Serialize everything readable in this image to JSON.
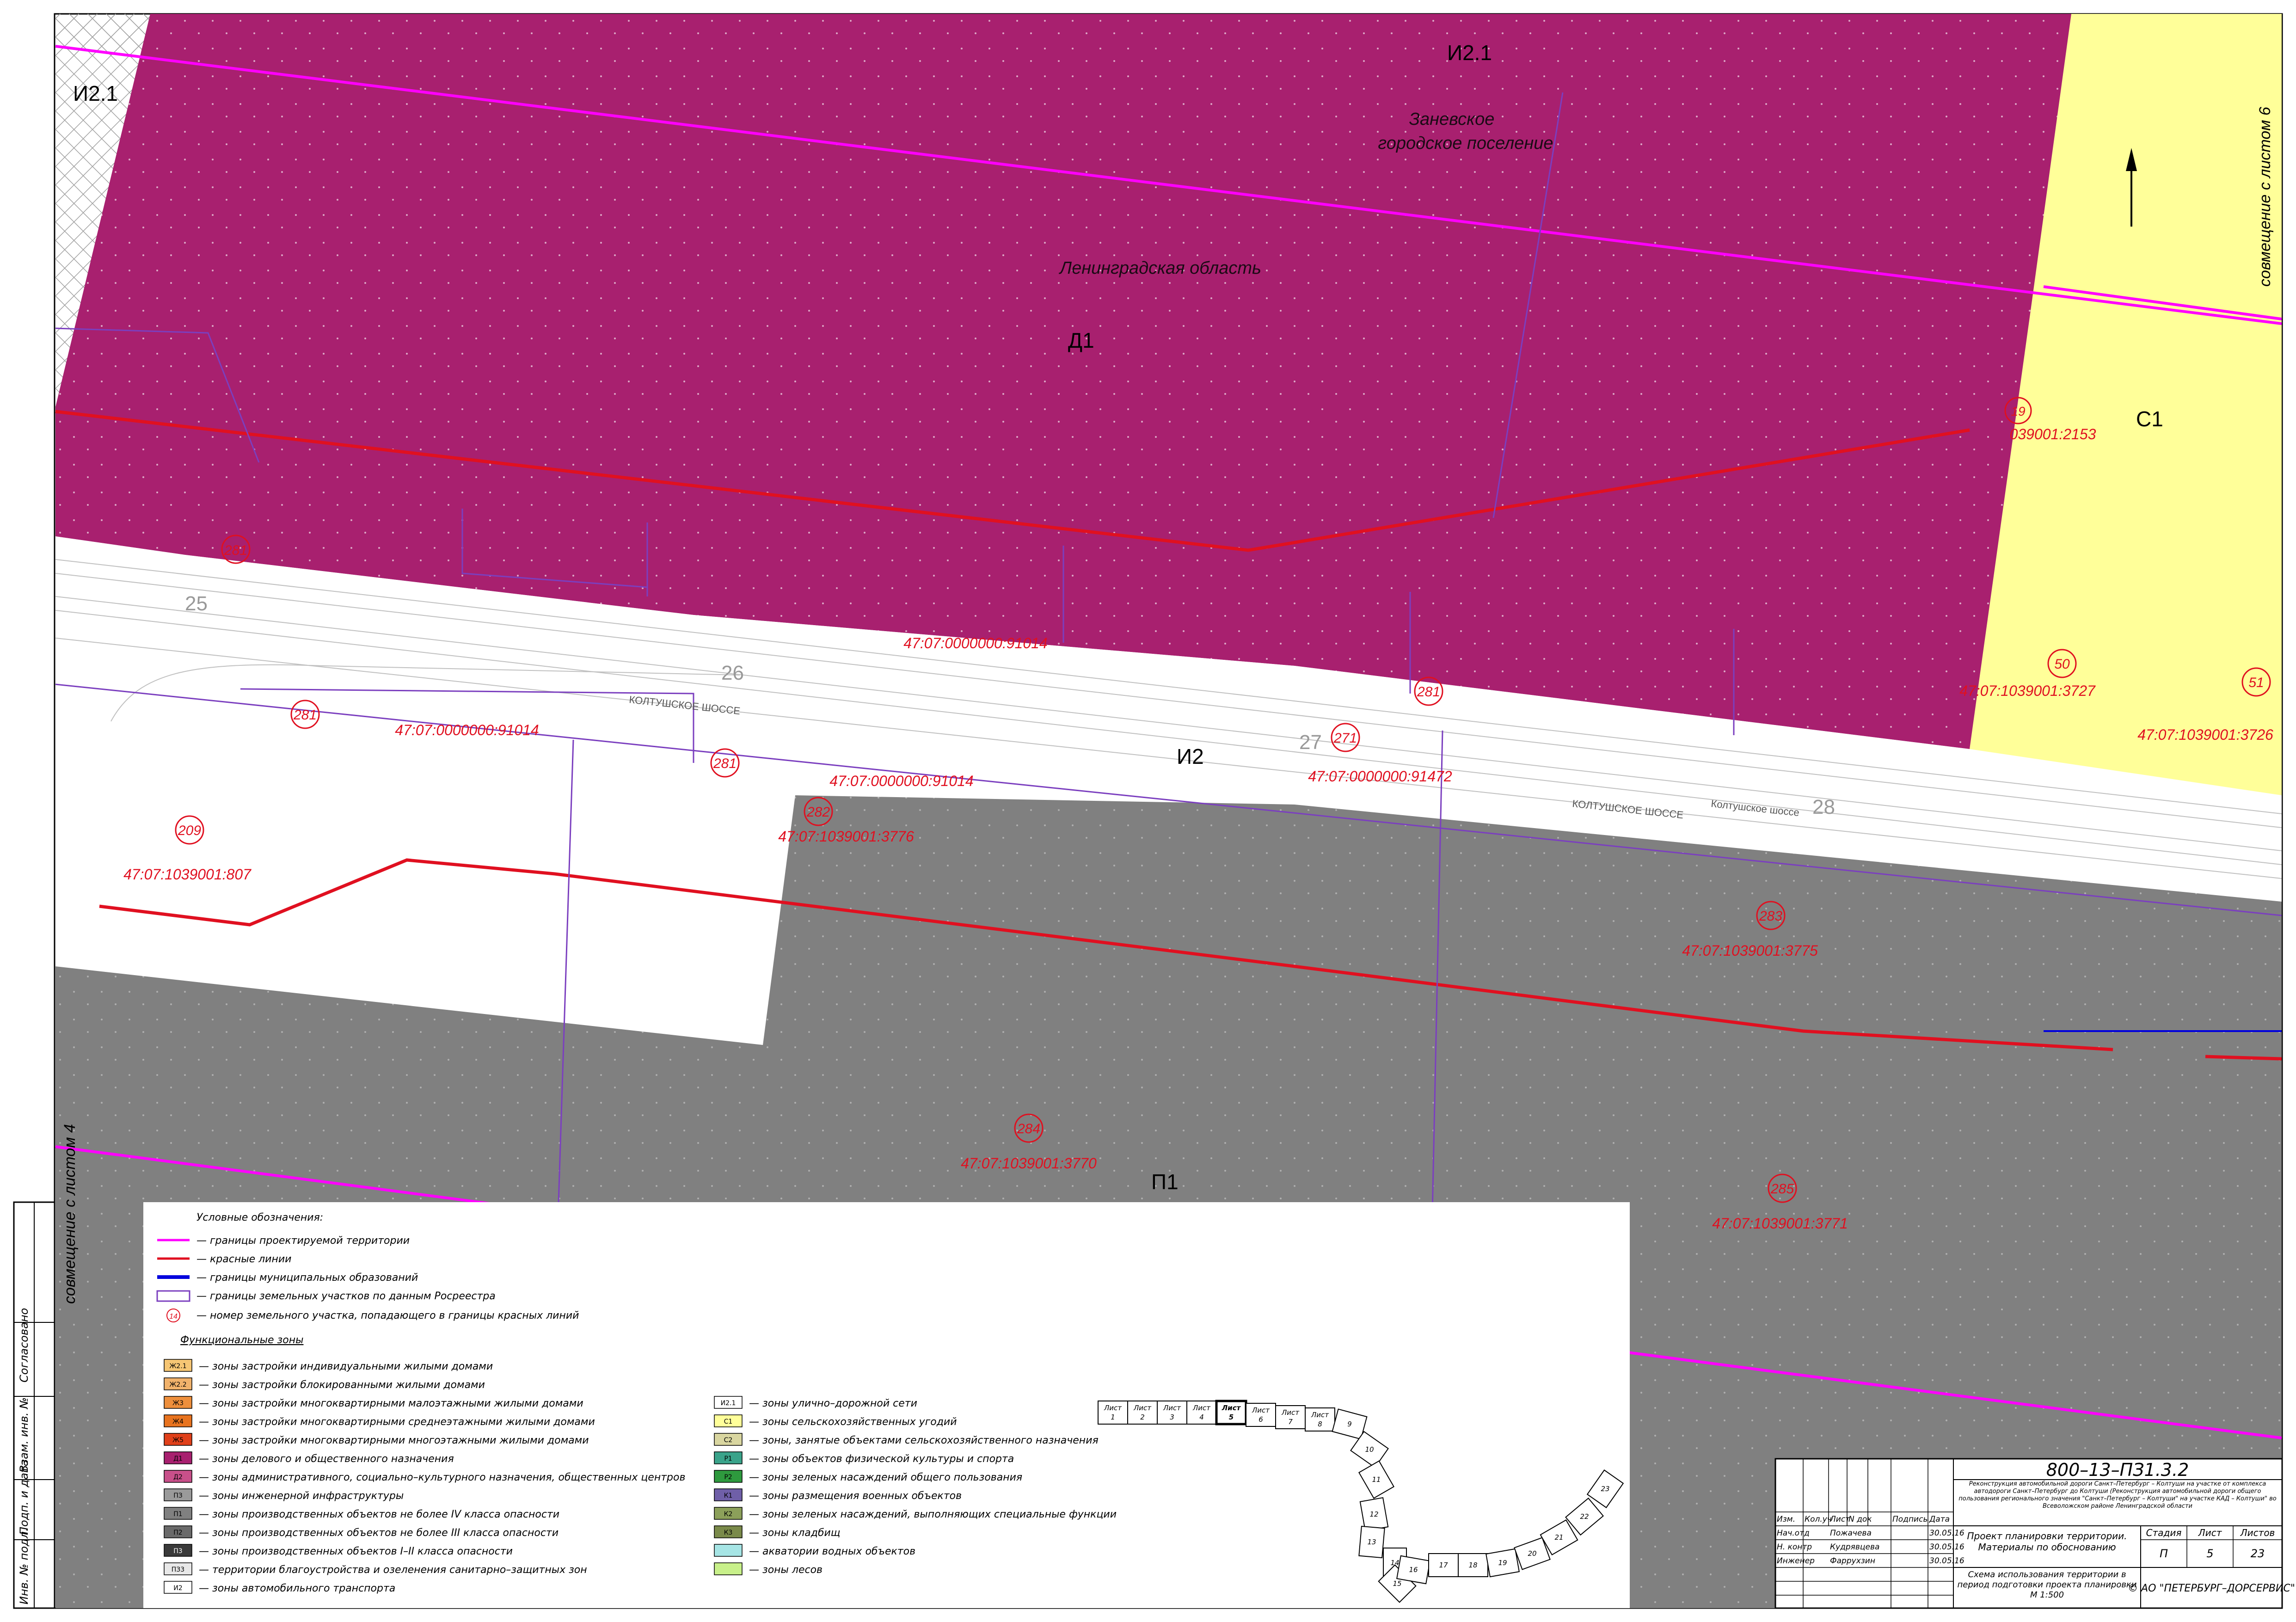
{
  "zones": {
    "d1": {
      "code": "Д1",
      "color": "#a8206f"
    },
    "i2": {
      "code": "И2"
    },
    "i21_left": {
      "code": "И2.1"
    },
    "i21_top": {
      "code": "И2.1"
    },
    "c1": {
      "code": "С1",
      "color": "#ffff99"
    },
    "p1": {
      "code": "П1",
      "color": "#808080"
    }
  },
  "place_labels": {
    "zanevskoe_1": "Заневское",
    "zanevskoe_2": "городское поселение",
    "region": "Ленинградская область"
  },
  "road_labels": {
    "koltushskoe_1": "КОЛТУШСКОЕ ШОССЕ",
    "koltushskoe_2": "КОЛТУШСКОЕ ШОССЕ",
    "koltushskoe_3": "Колтушское шоссе"
  },
  "sheet_numbers": [
    "25",
    "26",
    "27",
    "28"
  ],
  "parcels": [
    {
      "num": "281",
      "cad": "47:07:0000000:91014"
    },
    {
      "num": "281",
      "cad": "47:07:0000000:91014"
    },
    {
      "num": "281",
      "cad": "47:07:0000000:91014"
    },
    {
      "num": "281",
      "cad": ""
    },
    {
      "num": "271",
      "cad": "47:07:0000000:91472"
    },
    {
      "num": "282",
      "cad": "47:07:1039001:3776"
    },
    {
      "num": "209",
      "cad": "47:07:1039001:807"
    },
    {
      "num": "283",
      "cad": "47:07:1039001:3775"
    },
    {
      "num": "284",
      "cad": "47:07:1039001:3770"
    },
    {
      "num": "285",
      "cad": "47:07:1039001:3771"
    },
    {
      "num": "50",
      "cad": "47:07:1039001:3727"
    },
    {
      "num": "51",
      "cad": "47:07:1039001:3726"
    },
    {
      "num": "19",
      "cad": "039001:2153"
    }
  ],
  "side_notes": {
    "right": "совмещение с листом 6",
    "left": "совмещение с листом 4"
  },
  "left_stamp": [
    "Согласовано",
    "Взам. инв. №",
    "Подп. и дата",
    "Инв. № подл."
  ],
  "legend": {
    "title": "Условные обозначения:",
    "lines": [
      {
        "color": "#ff00ff",
        "text": "— границы проектируемой территории"
      },
      {
        "color": "#e01020",
        "text": "— красные линии"
      },
      {
        "color": "#0000dd",
        "text": "— границы муниципальных образований"
      },
      {
        "color": "#7b3fbf",
        "text": "— границы земельных участков по данным Росреестра"
      }
    ],
    "marker_note": "— номер земельного участка, попадающего в границы красных линий",
    "marker_symbol": "14",
    "func_title": "Функциональные зоны",
    "zones_left": [
      {
        "code": "Ж2.1",
        "color": "#f6c674",
        "text": "— зоны застройки индивидуальными жилыми домами"
      },
      {
        "code": "Ж2.2",
        "color": "#f1b26b",
        "text": "— зоны застройки блокированными жилыми домами"
      },
      {
        "code": "Ж3",
        "color": "#ee8f3c",
        "text": "— зоны застройки многоквартирными малоэтажными жилыми домами"
      },
      {
        "code": "Ж4",
        "color": "#e8731e",
        "text": "— зоны застройки многоквартирными среднеэтажными жилыми домами"
      },
      {
        "code": "Ж5",
        "color": "#e0401a",
        "text": "— зоны застройки многоквартирными многоэтажными жилыми домами"
      },
      {
        "code": "Д1",
        "color": "#a8206f",
        "text": "— зоны делового и общественного назначения"
      },
      {
        "code": "Д2",
        "color": "#c8508a",
        "text": "— зоны административного, социально–культурного назначения, общественных центров"
      },
      {
        "code": "ПЗ",
        "color": "#9a9a9a",
        "text": "— зоны инженерной инфраструктуры"
      },
      {
        "code": "П1",
        "color": "#808080",
        "text": "— зоны производственных объектов не более IV класса опасности"
      },
      {
        "code": "П2",
        "color": "#6a6a6a",
        "text": "— зоны производственных объектов не более III класса опасности"
      },
      {
        "code": "П3",
        "color": "#3a3a3a",
        "text": "— зоны производственных объектов I–II класса опасности"
      },
      {
        "code": "ПЗ3",
        "color": "#e8e8e8",
        "text": "— территории благоустройства и озеленения санитарно–защитных зон"
      },
      {
        "code": "И2",
        "color": "#ffffff",
        "text": "— зоны автомобильного транспорта"
      }
    ],
    "zones_right": [
      {
        "code": "И2.1",
        "color": "#ffffff",
        "text": "— зоны улично–дорожной сети"
      },
      {
        "code": "С1",
        "color": "#ffff99",
        "text": "— зоны сельскохозяйственных угодий"
      },
      {
        "code": "С2",
        "color": "#d9d6a0",
        "text": "— зоны, занятые объектами сельскохозяйственного назначения"
      },
      {
        "code": "Р1",
        "color": "#3aa38a",
        "text": "— зоны объектов физической культуры и спорта"
      },
      {
        "code": "Р2",
        "color": "#2e9a3e",
        "text": "— зоны зеленых насаждений общего пользования"
      },
      {
        "code": "К1",
        "color": "#6f5fa8",
        "text": "— зоны размещения военных объектов"
      },
      {
        "code": "К2",
        "color": "#8ca05a",
        "text": "— зоны зеленых насаждений, выполняющих специальные функции"
      },
      {
        "code": "К3",
        "color": "#7a8a4a",
        "text": "— зоны кладбищ"
      },
      {
        "code": "",
        "color": "#a6e5e5",
        "text": "— акватории водных объектов"
      },
      {
        "code": "",
        "color": "#c8f08a",
        "text": "— зоны лесов"
      }
    ]
  },
  "sheet_index": {
    "prefix": "Лист",
    "sheets": [
      "1",
      "2",
      "3",
      "4",
      "5",
      "6",
      "7",
      "8",
      "9",
      "10",
      "11",
      "12",
      "13",
      "14",
      "15",
      "16",
      "17",
      "18",
      "19",
      "20",
      "21",
      "22",
      "23"
    ],
    "current": "5"
  },
  "title_block": {
    "code": "800–13–ПЗ1.3.2",
    "project_desc": "Реконструкция автомобильной дороги Санкт–Петербург – Колтуши на участке от комплекса автодороги Санкт–Петербург до Колтуши (Реконструкция автомобильной дороги общего пользования регионального значения \"Санкт–Петербург – Колтуши\" на участке КАД – Колтуши\" во Всеволожском районе Ленинградской области",
    "headers": [
      "Изм.",
      "Кол.уч",
      "Лист",
      "N док",
      "Подпись",
      "Дата"
    ],
    "rows": [
      {
        "role": "Нач.отд",
        "name": "Пожачева",
        "date": "30.05.16"
      },
      {
        "role": "Н. контр",
        "name": "Кудрявцева",
        "date": "30.05.16"
      },
      {
        "role": "Инженер",
        "name": "Фаррухзин",
        "date": "30.05.16"
      }
    ],
    "doc_title": "Проект планировки территории. Материалы по обоснованию",
    "stage_hdr": "Стадия",
    "sheet_hdr": "Лист",
    "sheets_hdr": "Листов",
    "stage": "П",
    "sheet": "5",
    "sheets": "23",
    "sheet_title": "Схема использования территории в период подготовки проекта планировки",
    "scale": "М 1:500",
    "company": "© АО \"ПЕТЕРБУРГ–ДОРСЕРВИС\""
  }
}
